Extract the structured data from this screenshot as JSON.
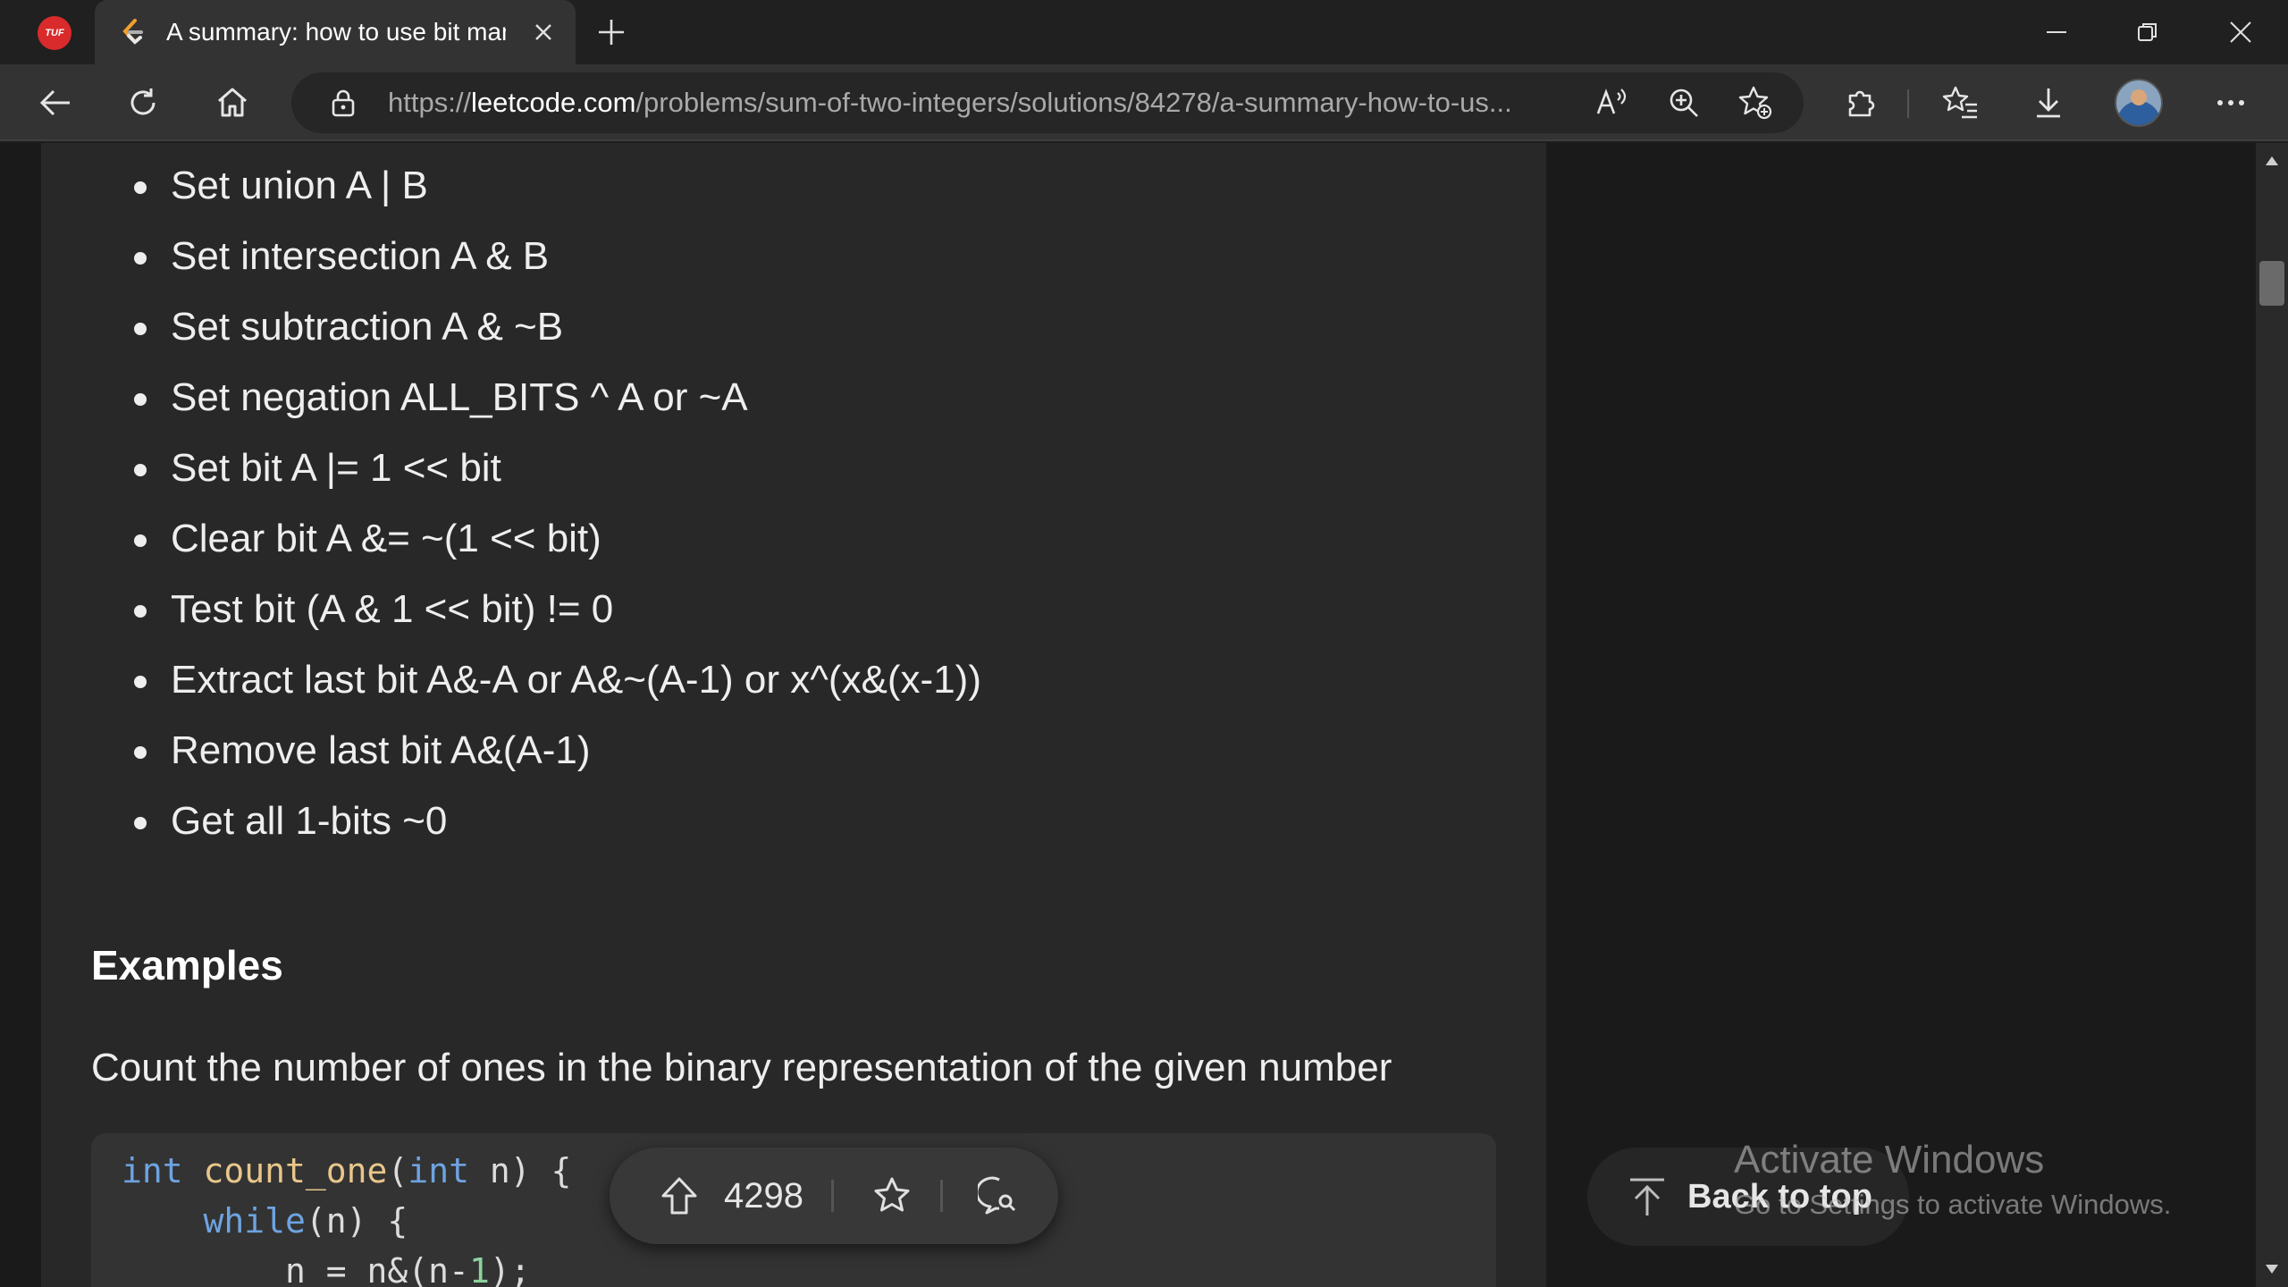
{
  "browser": {
    "app_badge": "TUF",
    "tab": {
      "title": "A summary: how to use bit manip",
      "favicon": "leetcode-icon"
    },
    "url": {
      "scheme": "https://",
      "host": "leetcode.com",
      "path": "/problems/sum-of-two-integers/solutions/84278/a-summary-how-to-us..."
    },
    "toolbar_icons": [
      "back-icon",
      "refresh-icon",
      "home-icon",
      "lock-icon",
      "read-aloud-icon",
      "zoom-icon",
      "add-favorite-icon",
      "extensions-icon",
      "favorites-icon",
      "downloads-icon",
      "more-icon"
    ]
  },
  "article": {
    "bullets": [
      "Set union A | B",
      "Set intersection A & B",
      "Set subtraction A & ~B",
      "Set negation ALL_BITS ^ A or ~A",
      "Set bit A |= 1 << bit",
      "Clear bit A &= ~(1 << bit)",
      "Test bit (A & 1 << bit) != 0",
      "Extract last bit A&-A or A&~(A-1) or x^(x&(x-1))",
      "Remove last bit A&(A-1)",
      "Get all 1-bits ~0"
    ],
    "section_title": "Examples",
    "paragraph": "Count the number of ones in the binary representation of the given number",
    "code": {
      "line1": {
        "kw1": "int",
        "fn": "count_one",
        "p1": "(",
        "kw2": "int",
        "p2": " n) {"
      },
      "line2": {
        "indent": "    ",
        "kw": "while",
        "rest": "(n) {"
      },
      "line3": {
        "indent": "        ",
        "a": "n = n&(n-",
        "num": "1",
        "b": ");"
      }
    }
  },
  "actions": {
    "vote_count": "4298",
    "back_to_top": "Back to top"
  },
  "watermark": {
    "title": "Activate Windows",
    "subtitle": "Go to Settings to activate Windows."
  }
}
